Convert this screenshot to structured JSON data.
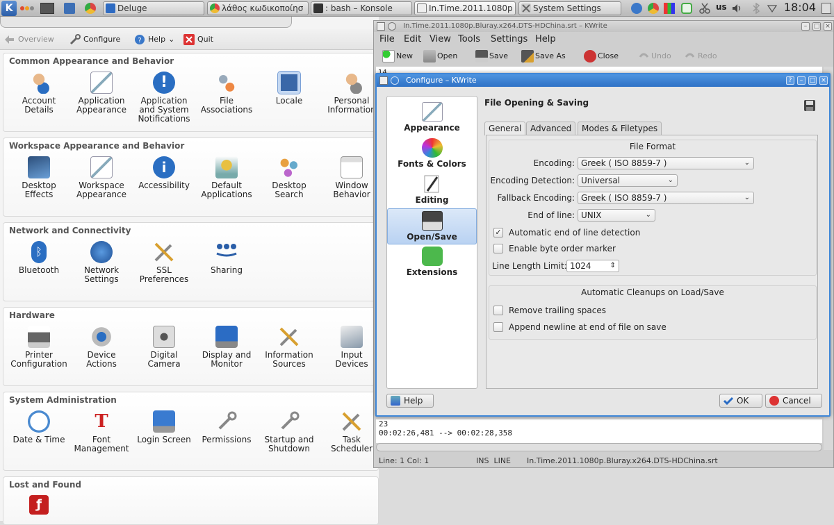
{
  "taskbar": {
    "tasks": [
      "Deluge",
      "λάθος κωδικοποίησ",
      ": bash – Konsole",
      "In.Time.2011.1080p",
      "System Settings"
    ],
    "layout": "us",
    "clock": "18:04"
  },
  "system_settings": {
    "toolbar": {
      "overview": "Overview",
      "configure": "Configure",
      "help": "Help",
      "quit": "Quit"
    },
    "sections": [
      {
        "title": "Common Appearance and Behavior",
        "modules": [
          "Account\nDetails",
          "Application\nAppearance",
          "Application\nand System\nNotifications",
          "File\nAssociations",
          "Locale",
          "Personal\nInformation"
        ]
      },
      {
        "title": "Workspace Appearance and Behavior",
        "modules": [
          "Desktop\nEffects",
          "Workspace\nAppearance",
          "Accessibility",
          "Default\nApplications",
          "Desktop\nSearch",
          "Window\nBehavior"
        ]
      },
      {
        "title": "Network and Connectivity",
        "modules": [
          "Bluetooth",
          "Network\nSettings",
          "SSL\nPreferences",
          "Sharing"
        ]
      },
      {
        "title": "Hardware",
        "modules": [
          "Printer\nConfiguration",
          "Device\nActions",
          "Digital\nCamera",
          "Display and\nMonitor",
          "Information\nSources",
          "Input\nDevices"
        ]
      },
      {
        "title": "System Administration",
        "modules": [
          "Date & Time",
          "Font\nManagement",
          "Login Screen",
          "Permissions",
          "Startup and\nShutdown",
          "Task\nScheduler"
        ]
      },
      {
        "title": "Lost and Found",
        "modules": [
          ""
        ]
      }
    ]
  },
  "kwrite": {
    "title": "In.Time.2011.1080p.Bluray.x264.DTS-HDChina.srt – KWrite",
    "menu": [
      "File",
      "Edit",
      "View",
      "Tools",
      "Settings",
      "Help"
    ],
    "toolbar": {
      "new": "New",
      "open": "Open",
      "save": "Save",
      "save_as": "Save As",
      "close": "Close",
      "undo": "Undo",
      "redo": "Redo"
    },
    "doc_top_line": "14",
    "doc_lines": [
      "23",
      "00:02:26,481 --> 00:02:28,358"
    ],
    "status": {
      "position": "Line: 1 Col: 1",
      "mode": "INS  LINE",
      "filename": "In.Time.2011.1080p.Bluray.x264.DTS-HDChina.srt"
    }
  },
  "dialog": {
    "title": "Configure – KWrite",
    "categories": [
      "Appearance",
      "Fonts & Colors",
      "Editing",
      "Open/Save",
      "Extensions"
    ],
    "page_title": "File Opening & Saving",
    "tabs": [
      "General",
      "Advanced",
      "Modes & Filetypes"
    ],
    "file_format": {
      "title": "File Format",
      "encoding_label": "Encoding:",
      "encoding_value": "Greek ( ISO 8859-7 )",
      "detection_label": "Encoding Detection:",
      "detection_value": "Universal",
      "fallback_label": "Fallback Encoding:",
      "fallback_value": "Greek ( ISO 8859-7 )",
      "eol_label": "End of line:",
      "eol_value": "UNIX",
      "auto_eol": "Automatic end of line detection",
      "bom": "Enable byte order marker",
      "line_length_label": "Line Length Limit:",
      "line_length_value": "1024"
    },
    "cleanups": {
      "title": "Automatic Cleanups on Load/Save",
      "trailing": "Remove trailing spaces",
      "newline": "Append newline at end of file on save"
    },
    "buttons": {
      "help": "Help",
      "ok": "OK",
      "cancel": "Cancel"
    }
  }
}
